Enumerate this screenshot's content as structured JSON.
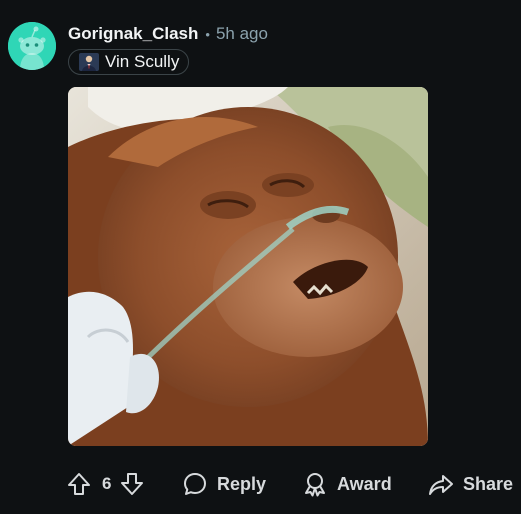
{
  "comment": {
    "username": "Gorignak_Clash",
    "separator": "•",
    "time_ago": "5h ago",
    "flair_label": "Vin Scully",
    "avatar_color": "#2fd6b6",
    "media_description_icon": "photo-icon"
  },
  "actions": {
    "upvote_icon": "upvote-icon",
    "vote_count": "6",
    "downvote_icon": "downvote-icon",
    "reply_label": "Reply",
    "award_label": "Award",
    "share_label": "Share"
  },
  "colors": {
    "background": "#0e1113",
    "username": "#f2f4f5",
    "meta": "#8ba2ad",
    "action_text": "#d7dadc"
  }
}
